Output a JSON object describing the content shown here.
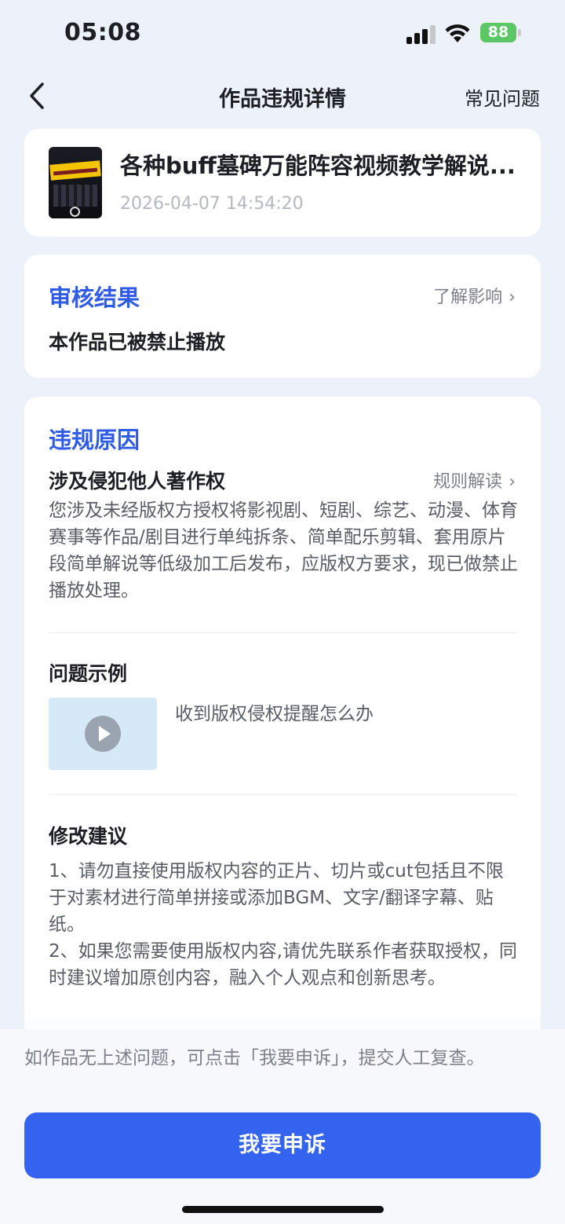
{
  "status_bar": {
    "time": "05:08",
    "battery": "88"
  },
  "nav": {
    "title": "作品违规详情",
    "faq_label": "常见问题",
    "back_icon": "chevron-left-icon"
  },
  "work": {
    "title": "各种buff墓碑万能阵容视频教学解说...",
    "timestamp": "2026-04-07 14:54:20"
  },
  "review": {
    "heading": "审核结果",
    "impact_link": "了解影响",
    "result": "本作品已被禁止播放"
  },
  "violation": {
    "heading": "违规原因",
    "reason_title": "涉及侵犯他人著作权",
    "rules_link": "规则解读",
    "reason_body": "您涉及未经版权方授权将影视剧、短剧、综艺、动漫、体育赛事等作品/剧目进行单纯拆条、简单配乐剪辑、套用原片段简单解说等低级加工后发布，应版权方要求，现已做禁止播放处理。",
    "example_heading": "问题示例",
    "example_text": "收到版权侵权提醒怎么办",
    "suggest_heading": "修改建议",
    "suggest_1": "1、请勿直接使用版权内容的正片、切片或cut包括且不限于对素材进行简单拼接或添加BGM、文字/翻译字幕、贴纸。",
    "suggest_2": "2、如果您需要使用版权内容,请优先联系作者获取授权，同时建议增加原创内容，融入个人观点和创新思考。"
  },
  "appeal": {
    "note": "如作品无上述问题，可点击「我要申诉」，提交人工复查。",
    "button_label": "我要申诉"
  },
  "colors": {
    "accent": "#3464ef",
    "heading_blue": "#2f5be6",
    "battery_green": "#5cc765"
  }
}
